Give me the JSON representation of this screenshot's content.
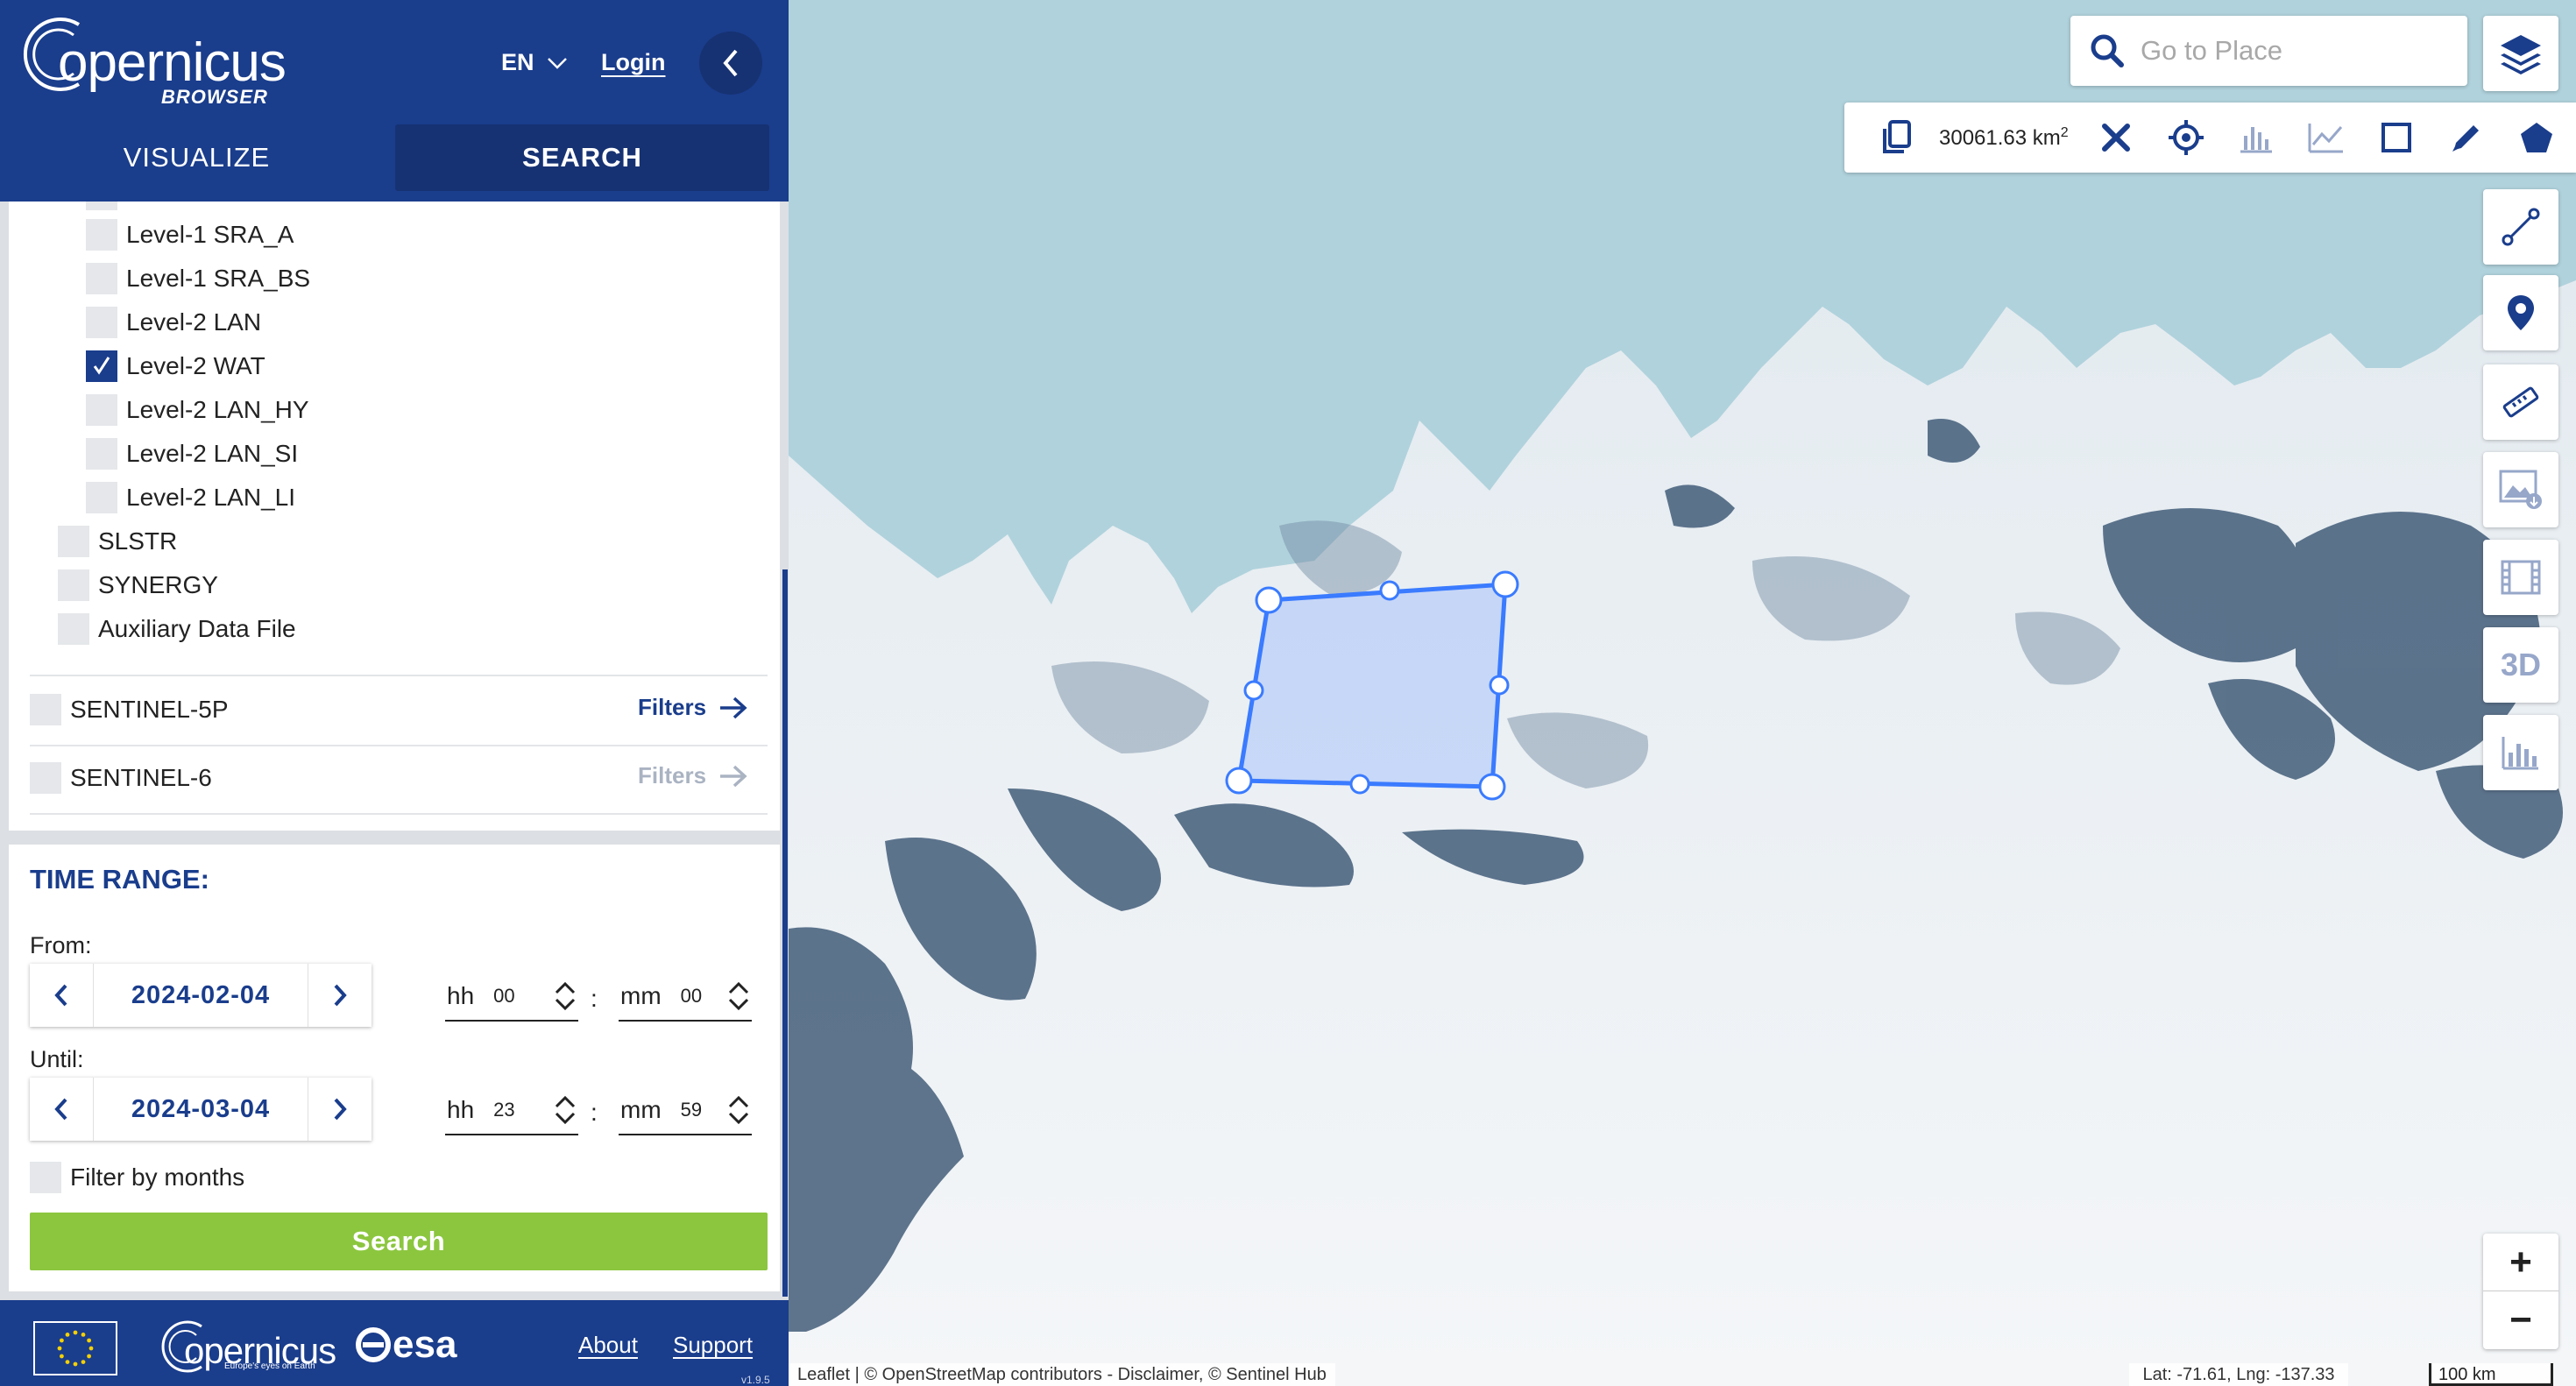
{
  "app": {
    "logo_text": "opernicus",
    "logo_initial": "C",
    "subtitle": "BROWSER",
    "language": "EN",
    "login_label": "Login"
  },
  "tabs": [
    {
      "label": "VISUALIZE",
      "active": false
    },
    {
      "label": "SEARCH",
      "active": true
    }
  ],
  "datasets": {
    "sentinel3_levels": [
      {
        "label": "Level-1 SRA_A",
        "checked": false
      },
      {
        "label": "Level-1 SRA_BS",
        "checked": false
      },
      {
        "label": "Level-2 LAN",
        "checked": false
      },
      {
        "label": "Level-2 WAT",
        "checked": true
      },
      {
        "label": "Level-2 LAN_HY",
        "checked": false
      },
      {
        "label": "Level-2 LAN_SI",
        "checked": false
      },
      {
        "label": "Level-2 LAN_LI",
        "checked": false
      }
    ],
    "sentinel3_instruments": [
      {
        "label": "SLSTR",
        "checked": false
      },
      {
        "label": "SYNERGY",
        "checked": false
      },
      {
        "label": "Auxiliary Data File",
        "checked": false
      }
    ],
    "missions": [
      {
        "label": "SENTINEL-5P",
        "filters_label": "Filters",
        "filters_enabled": true
      },
      {
        "label": "SENTINEL-6",
        "filters_label": "Filters",
        "filters_enabled": false
      }
    ]
  },
  "time_range": {
    "title": "TIME RANGE:",
    "from": {
      "label": "From:",
      "date": "2024-02-04",
      "hh_label": "hh",
      "hh": "00",
      "mm_label": "mm",
      "mm": "00"
    },
    "until": {
      "label": "Until:",
      "date": "2024-03-04",
      "hh_label": "hh",
      "hh": "23",
      "mm_label": "mm",
      "mm": "59"
    },
    "colon": ":",
    "filter_by_months": "Filter by months",
    "search_label": "Search"
  },
  "footer": {
    "copernicus_word": "opernicus",
    "copernicus_initial": "C",
    "copernicus_tagline": "Europe's eyes on Earth",
    "esa_label": "esa",
    "about_label": "About",
    "support_label": "Support",
    "version": "v1.9.5"
  },
  "map": {
    "search_placeholder": "Go to Place",
    "aoi_area_value": "30061.63 km",
    "aoi_area_sup": "2",
    "attribution": "Leaflet | © OpenStreetMap contributors - Disclaimer, © Sentinel Hub",
    "coordinates": "Lat: -71.61, Lng: -137.33",
    "scale": "100 km",
    "zoom_in": "+",
    "zoom_out": "−",
    "rail_3d_label": "3D",
    "colors": {
      "brand": "#1a3d8c",
      "search_button": "#8cc63f",
      "aoi": "#3a7bff"
    }
  }
}
